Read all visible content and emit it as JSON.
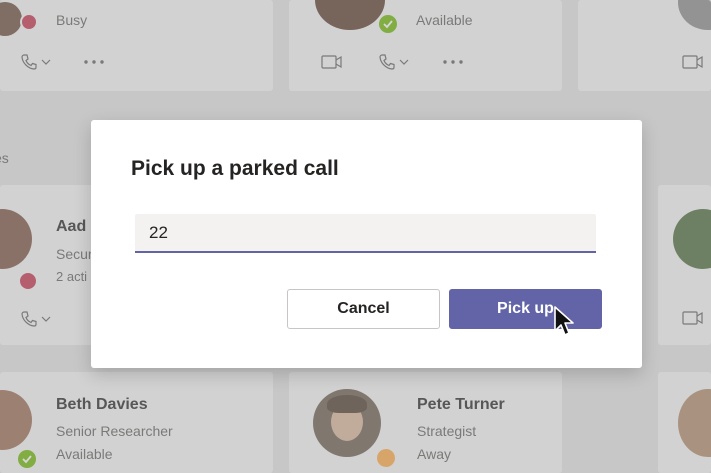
{
  "background": {
    "top_left": {
      "status_text": "Busy"
    },
    "top_middle": {
      "status_text": "Available"
    },
    "section_label": "es",
    "mid_left": {
      "name": "Aad",
      "title": "Secur",
      "detail": "2 acti"
    },
    "bottom_left": {
      "name": "Beth Davies",
      "title": "Senior Researcher",
      "status_text": "Available"
    },
    "bottom_middle": {
      "name": "Pete Turner",
      "title": "Strategist",
      "status_text": "Away"
    }
  },
  "icons": {
    "call": "phone-icon",
    "chevron": "chevron-down-icon",
    "more": "more-icon",
    "video": "video-icon"
  },
  "dialog": {
    "title": "Pick up a parked call",
    "input_value": "22",
    "cancel_label": "Cancel",
    "pickup_label": "Pick up"
  },
  "colors": {
    "accent": "#6264a7",
    "busy": "#c4314b",
    "available": "#6bb700",
    "away": "#ffaa44"
  }
}
